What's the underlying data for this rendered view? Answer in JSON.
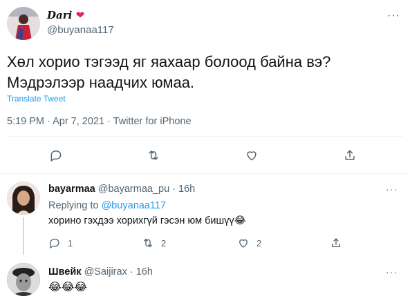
{
  "main_tweet": {
    "display_name": "Dari",
    "handle": "@buyanaa117",
    "text_line1": "Хөл хорио тэгээд яг яахаар болоод байна вэ?",
    "text_line2": "Мэдрэлээр наадчих юмаа.",
    "translate_label": "Translate Tweet",
    "timestamp": "5:19 PM · Apr 7, 2021 · Twitter for iPhone",
    "actions": [
      "reply-icon",
      "retweet-icon",
      "like-icon",
      "share-icon"
    ]
  },
  "replies": [
    {
      "display_name": "bayarmaa",
      "handle_time": "@bayarmaa_pu · 16h",
      "replying_prefix": "Replying to ",
      "replying_handle": "@buyanaa117",
      "text": "хорино гэхдээ хорихгүй гэсэн юм бишүү😂",
      "reply_count": "1",
      "retweet_count": "2",
      "like_count": "2"
    },
    {
      "display_name": "Швейк",
      "handle_time": "@Saijirax · 16h",
      "text": "😂😂😂"
    }
  ],
  "colors": {
    "accent": "#1d9bf0",
    "muted": "#536471",
    "heart": "#e0245e",
    "divider": "#eff3f4"
  }
}
